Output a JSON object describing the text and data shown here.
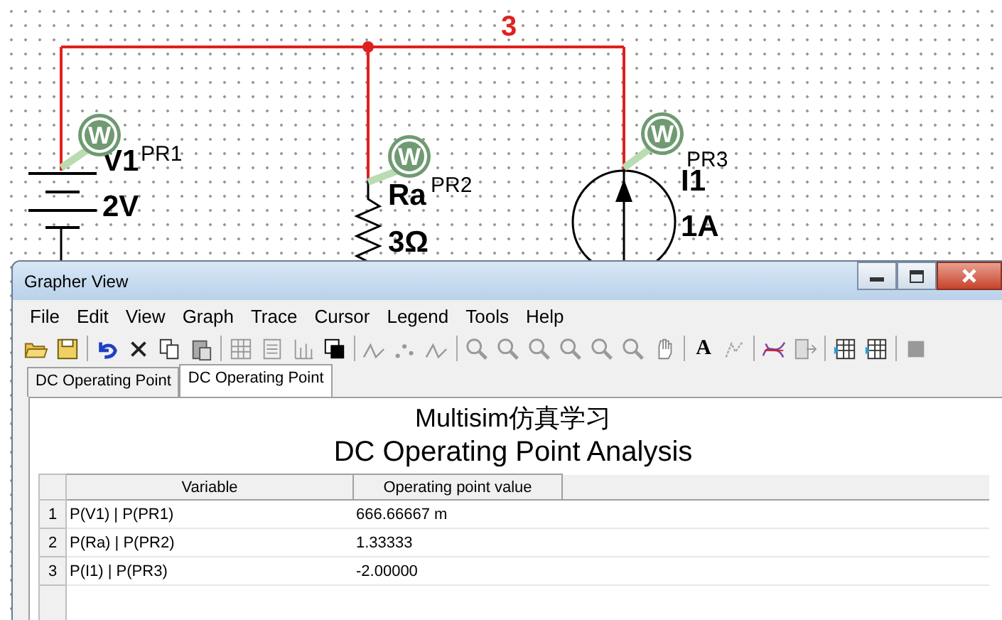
{
  "schematic": {
    "net_label": "3",
    "components": [
      {
        "kind": "battery",
        "name": "V1",
        "value": "2V",
        "probe": {
          "symbol": "W",
          "label": "PR1"
        }
      },
      {
        "kind": "resistor",
        "name": "Ra",
        "value": "3Ω",
        "probe": {
          "symbol": "W",
          "label": "PR2"
        }
      },
      {
        "kind": "current_source",
        "name": "I1",
        "value": "1A",
        "probe": {
          "symbol": "W",
          "label": "PR3"
        }
      }
    ]
  },
  "window": {
    "title": "Grapher View",
    "menu": [
      "File",
      "Edit",
      "View",
      "Graph",
      "Trace",
      "Cursor",
      "Legend",
      "Tools",
      "Help"
    ],
    "toolbar": [
      {
        "kind": "open"
      },
      {
        "kind": "save"
      },
      {
        "kind": "sep"
      },
      {
        "kind": "undo"
      },
      {
        "kind": "delete"
      },
      {
        "kind": "copy"
      },
      {
        "kind": "paste"
      },
      {
        "kind": "sep"
      },
      {
        "kind": "grid"
      },
      {
        "kind": "legend"
      },
      {
        "kind": "ticks"
      },
      {
        "kind": "background"
      },
      {
        "kind": "sep"
      },
      {
        "kind": "line"
      },
      {
        "kind": "points"
      },
      {
        "kind": "line"
      },
      {
        "kind": "sep"
      },
      {
        "kind": "zoom"
      },
      {
        "kind": "zoom"
      },
      {
        "kind": "zoom"
      },
      {
        "kind": "zoom"
      },
      {
        "kind": "zoom"
      },
      {
        "kind": "zoom"
      },
      {
        "kind": "hand"
      },
      {
        "kind": "sep"
      },
      {
        "kind": "text",
        "label": "A"
      },
      {
        "kind": "label"
      },
      {
        "kind": "sep"
      },
      {
        "kind": "cursor"
      },
      {
        "kind": "export"
      },
      {
        "kind": "sep"
      },
      {
        "kind": "sheet"
      },
      {
        "kind": "sheet"
      },
      {
        "kind": "sep"
      },
      {
        "kind": "stop"
      }
    ],
    "tabs": [
      {
        "label": "DC Operating Point",
        "selected": false
      },
      {
        "label": "DC Operating Point",
        "selected": true
      }
    ],
    "heading": [
      "Multisim仿真学习",
      "DC Operating Point Analysis"
    ],
    "table": {
      "columns": [
        "Variable",
        "Operating point value"
      ],
      "rows": [
        {
          "index": "1",
          "variable": "P(V1) | P(PR1)",
          "value": "666.66667 m"
        },
        {
          "index": "2",
          "variable": "P(Ra) | P(PR2)",
          "value": "1.33333"
        },
        {
          "index": "3",
          "variable": "P(I1) | P(PR3)",
          "value": "-2.00000"
        }
      ]
    }
  }
}
